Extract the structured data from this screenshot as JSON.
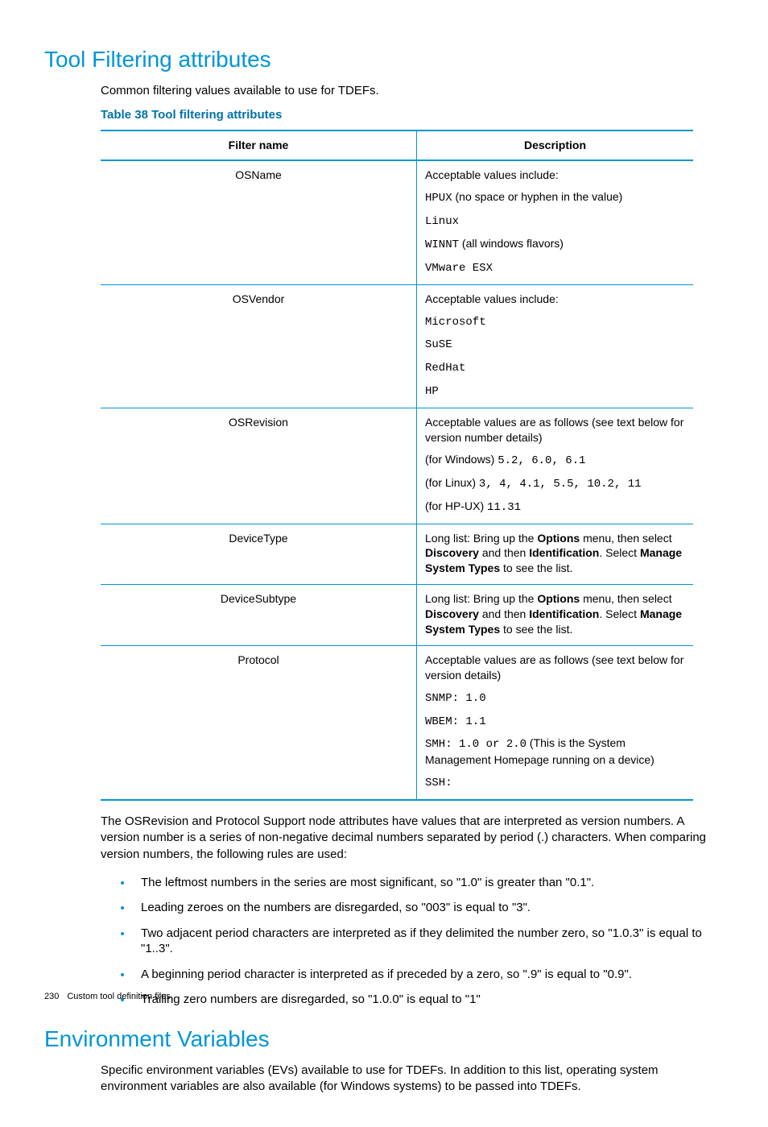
{
  "section1": {
    "heading": "Tool Filtering attributes",
    "lead": "Common filtering values available to use for TDEFs.",
    "caption": "Table 38 Tool filtering attributes",
    "th1": "Filter name",
    "th2": "Description"
  },
  "rows": {
    "r0": {
      "name": "OSName",
      "d0": "Acceptable values include:",
      "d1a": "HPUX",
      "d1b": " (no space or hyphen in the value)",
      "d2": "Linux",
      "d3a": "WINNT",
      "d3b": " (all windows flavors)",
      "d4": "VMware ESX"
    },
    "r1": {
      "name": "OSVendor",
      "d0": "Acceptable values include:",
      "d1": "Microsoft",
      "d2": "SuSE",
      "d3": "RedHat",
      "d4": "HP"
    },
    "r2": {
      "name": "OSRevision",
      "d0": "Acceptable values are as follows (see text below for version number details)",
      "d1pre": "(for Windows) ",
      "d1m": "5.2, 6.0, 6.1",
      "d2pre": "(for Linux) ",
      "d2m": "3, 4, 4.1, 5.5, 10.2, 11",
      "d3pre": "(for HP-UX) ",
      "d3m": "11.31"
    },
    "r3": {
      "name": "DeviceType",
      "pre": "Long list: Bring up the ",
      "b1": "Options",
      "mid1": " menu, then select ",
      "b2": "Discovery",
      "mid2": " and then ",
      "b3": "Identification",
      "mid3": ". Select ",
      "b4": "Manage System Types",
      "post": " to see the list."
    },
    "r4": {
      "name": "DeviceSubtype",
      "pre": "Long list: Bring up the ",
      "b1": "Options",
      "mid1": " menu, then select ",
      "b2": "Discovery",
      "mid2": " and then ",
      "b3": "Identification",
      "mid3": ". Select ",
      "b4": "Manage System Types",
      "post": " to see the list."
    },
    "r5": {
      "name": "Protocol",
      "d0": "Acceptable values are as follows (see text below for version details)",
      "d1": "SNMP: 1.0",
      "d2": "WBEM: 1.1",
      "d3a": "SMH: 1.0 or 2.0",
      "d3b": " (This is the System Management Homepage running on a device)",
      "d4": "SSH:"
    }
  },
  "para": "The OSRevision and Protocol Support node attributes have values that are interpreted as version numbers. A version number is a series of non-negative decimal numbers separated by period (.) characters. When comparing version numbers, the following rules are used:",
  "bullets": {
    "b0": "The leftmost numbers in the series are most significant, so \"1.0\" is greater than \"0.1\".",
    "b1": "Leading zeroes on the numbers are disregarded, so \"003\" is equal to \"3\".",
    "b2": "Two adjacent period characters are interpreted as if they delimited the number zero, so \"1.0.3\" is equal to \"1..3\".",
    "b3": "A beginning period character is interpreted as if preceded by a zero, so \".9\" is equal to \"0.9\".",
    "b4": "Trailing zero numbers are disregarded, so \"1.0.0\" is equal to \"1\""
  },
  "section2": {
    "heading": "Environment Variables",
    "lead": "Specific environment variables (EVs) available to use for TDEFs. In addition to this list, operating system environment variables are also available (for Windows systems) to be passed into TDEFs."
  },
  "footer": {
    "page": "230",
    "title": "Custom tool definition files"
  }
}
